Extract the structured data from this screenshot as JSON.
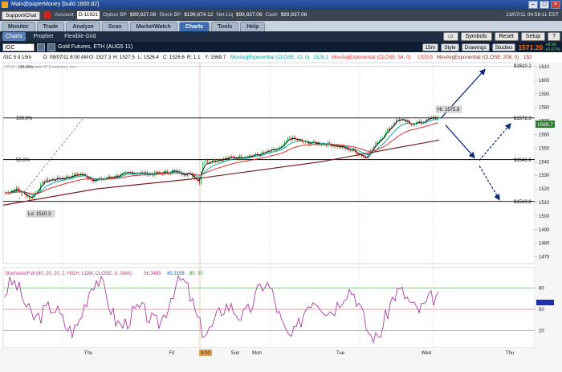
{
  "window": {
    "title": "Main@paperMoney [build 1800.82]",
    "datetime": "13/07/11 04:58:11 EST"
  },
  "account": {
    "support_label": "Support/Chat",
    "account_label": "Account",
    "account_value": "D-11921",
    "option_bp_label": "Option BP",
    "option_bp_value": "$99,837.06",
    "stock_bp_label": "Stock BP",
    "stock_bp_value": "$199,674.12",
    "net_liq_label": "Net Liq",
    "net_liq_value": "$99,837.06",
    "cash_label": "Cash",
    "cash_value": "$99,837.06"
  },
  "main_tabs": [
    "Monitor",
    "Trade",
    "Analyze",
    "Scan",
    "MarketWatch",
    "Charts",
    "Tools",
    "Help"
  ],
  "active_tab": "Charts",
  "sub_tabs": [
    "Charts",
    "Prophet",
    "Flexible Grid"
  ],
  "toolbar": {
    "symbols": "Symbols",
    "reset": "Reset",
    "setup": "Setup"
  },
  "chart_header": {
    "symbol": "/GC",
    "description": "Gold Futures, ETH (AUG5 11)",
    "interval": "15m",
    "style": "Style",
    "drawings": "Drawings",
    "studies": "Studies",
    "last_price": "1571.20",
    "change": "+8.90",
    "change_pct": "+0.57%"
  },
  "study_line": {
    "interval": "/GC 5 d 15m",
    "date": "D: 08/07/11 8:00 AM",
    "open": "O: 1527.3",
    "high": "H: 1527.5",
    "low": "L: 1526.4",
    "close": "C: 1526.6",
    "range": "R: 1.1",
    "y": "Y: 1569.7",
    "ema12": "MovAvgExponential (CLOSE, 12, 0)",
    "ema12_val": "1528.1",
    "ema54": "MovAvgExponential (CLOSE, 54, 0)",
    "ema54_val": "1529.5",
    "ema208": "MovAvgExponential (CLOSE, 208, 0)",
    "ema208_val": "152"
  },
  "copyright": "2010 ... Ameritrade IP Company, Inc.",
  "fib_top_pct": "161.8%",
  "price_axis": [
    "1610",
    "1600",
    "1590",
    "1580",
    "1570",
    "1560",
    "1550",
    "1540",
    "1530",
    "1520",
    "1510",
    "1500",
    "1490",
    "1480",
    "1470"
  ],
  "levels": {
    "top": {
      "pct": "100.0%",
      "price": "$1572.3"
    },
    "mid": {
      "pct": "50.0%",
      "price": "$1541.6"
    },
    "low": {
      "price": "$1510.8"
    },
    "upper": {
      "price": "$1610.2"
    }
  },
  "hi_label": "Hi: 1575.9",
  "lo_label": "Lo: 1510.3",
  "current_price_tag": "1569.7",
  "stochastic": {
    "label": "StochasticFull (80, 20, 20, 2, HIGH, LOW, CLOSE, 3, SMA)",
    "v1": "36.3485",
    "v2": "40.3158",
    "v3": "80",
    "v4": "20"
  },
  "time_axis": [
    "Thu",
    "Fri",
    "8:00",
    "Sun",
    "Mon",
    "Tue",
    "Wed",
    "Thu"
  ],
  "colors": {
    "ema12": "#00a0a0",
    "ema54": "#e03030",
    "ema208": "#7a1f1f",
    "stoch": "#b03aa8",
    "arrow": "#0d2c7a"
  }
}
